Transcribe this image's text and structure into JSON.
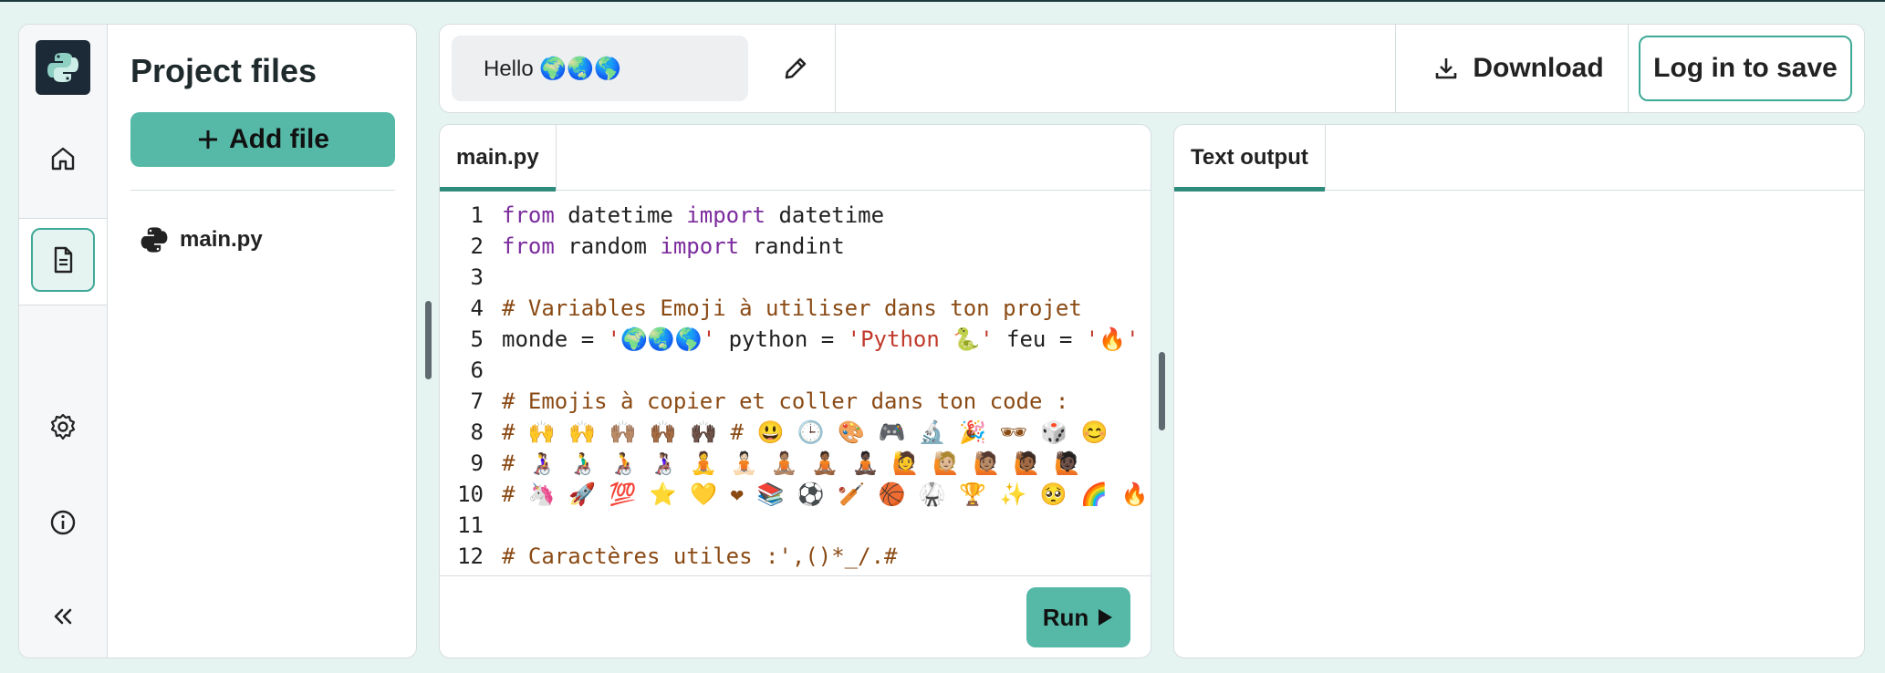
{
  "sidebar": {
    "title": "Project files",
    "add_file_label": "Add file",
    "files": [
      {
        "name": "main.py"
      }
    ]
  },
  "topbar": {
    "project_name": "Hello 🌍🌏🌎",
    "download_label": "Download",
    "login_label": "Log in to save"
  },
  "editor": {
    "tab": "main.py",
    "lines": [
      {
        "n": "1",
        "tokens": [
          {
            "t": "from",
            "c": "kw"
          },
          {
            "t": " datetime "
          },
          {
            "t": "import",
            "c": "kw"
          },
          {
            "t": " datetime"
          }
        ]
      },
      {
        "n": "2",
        "tokens": [
          {
            "t": "from",
            "c": "kw"
          },
          {
            "t": " random "
          },
          {
            "t": "import",
            "c": "kw"
          },
          {
            "t": " randint"
          }
        ]
      },
      {
        "n": "3",
        "tokens": []
      },
      {
        "n": "4",
        "tokens": [
          {
            "t": "# Variables Emoji à utiliser dans ton projet",
            "c": "cm"
          }
        ]
      },
      {
        "n": "5",
        "tokens": [
          {
            "t": "monde = "
          },
          {
            "t": "'🌍🌏🌎'",
            "c": "str"
          },
          {
            "t": " python = "
          },
          {
            "t": "'Python 🐍'",
            "c": "str"
          },
          {
            "t": " feu = "
          },
          {
            "t": "'🔥'",
            "c": "str"
          }
        ]
      },
      {
        "n": "6",
        "tokens": []
      },
      {
        "n": "7",
        "tokens": [
          {
            "t": "# Emojis à copier et coller dans ton code :",
            "c": "cm"
          }
        ]
      },
      {
        "n": "8",
        "tokens": [
          {
            "t": "# 🙌 🙌 🙌🏽 🙌🏾 🙌🏿 # 😃 🕒 🎨 🎮 🔬 🎉 🕶 🎲 😊",
            "c": "cm"
          }
        ]
      },
      {
        "n": "9",
        "tokens": [
          {
            "t": "# 👩‍🦽 👨‍🦽 🧑‍🦽 👩🏽‍🦽 🧘 🧘🏻 🧘🏽 🧘🏾 🧘🏿 🙋 🙋🏼 🙋🏽 🙋🏾 🙋🏿",
            "c": "cm"
          }
        ]
      },
      {
        "n": "10",
        "tokens": [
          {
            "t": "# 🦄 🚀 💯 ⭐ 💛 ❤ 📚 ⚽ 🏏 🏀 🥋 🏆 ✨ 🥺 🌈 🔥 ♻ 🌳",
            "c": "cm"
          }
        ]
      },
      {
        "n": "11",
        "tokens": []
      },
      {
        "n": "12",
        "tokens": [
          {
            "t": "# Caractères utiles :',()*_/.#",
            "c": "cm"
          }
        ]
      }
    ],
    "run_label": "Run"
  },
  "output": {
    "tab": "Text output"
  },
  "colors": {
    "accent": "#56b9a8",
    "accent_border": "#3fa997",
    "tab_underline": "#2f8b7b",
    "keyword": "#7b2b9d",
    "string": "#c0392b",
    "comment": "#8a4a14",
    "background": "#e6f4f1"
  },
  "icons": [
    "python-logo-icon",
    "home-icon",
    "file-icon",
    "gear-icon",
    "info-icon",
    "collapse-icon",
    "plus-icon",
    "pencil-icon",
    "download-icon",
    "play-icon"
  ]
}
